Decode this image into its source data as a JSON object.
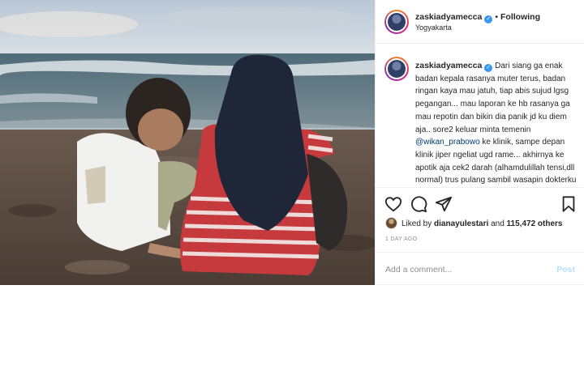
{
  "header": {
    "username": "zaskiadyamecca",
    "follow_label": "Following",
    "separator": "•",
    "location": "Yogyakarta"
  },
  "caption": {
    "username": "zaskiadyamecca",
    "text_part1": "Dari siang ga enak badan kepala rasanya muter terus, badan ringan kaya mau jatuh, tiap abis sujud lgsg pegangan... mau laporan ke hb rasanya ga mau repotin dan bikin dia panik jd ku diem aja.. sore2 keluar minta temenin ",
    "mention": "@wikan_prabowo",
    "text_part2": " ke klinik, sampe depan klinik jiper ngeliat ugd rame... akhirnya ke apotik aja cek2 darah (alhamdulillah tensi,dll normal) trus pulang sambil wasapin dokterku"
  },
  "actions": {
    "like_icon": "heart-icon",
    "comment_icon": "comment-icon",
    "share_icon": "share-icon",
    "save_icon": "bookmark-icon"
  },
  "likes": {
    "prefix": "Liked by ",
    "user": "dianayulestari",
    "middle": " and ",
    "count": "115,472 others"
  },
  "time_ago": "1 DAY AGO",
  "comment_box": {
    "placeholder": "Add a comment...",
    "post_label": "Post"
  }
}
